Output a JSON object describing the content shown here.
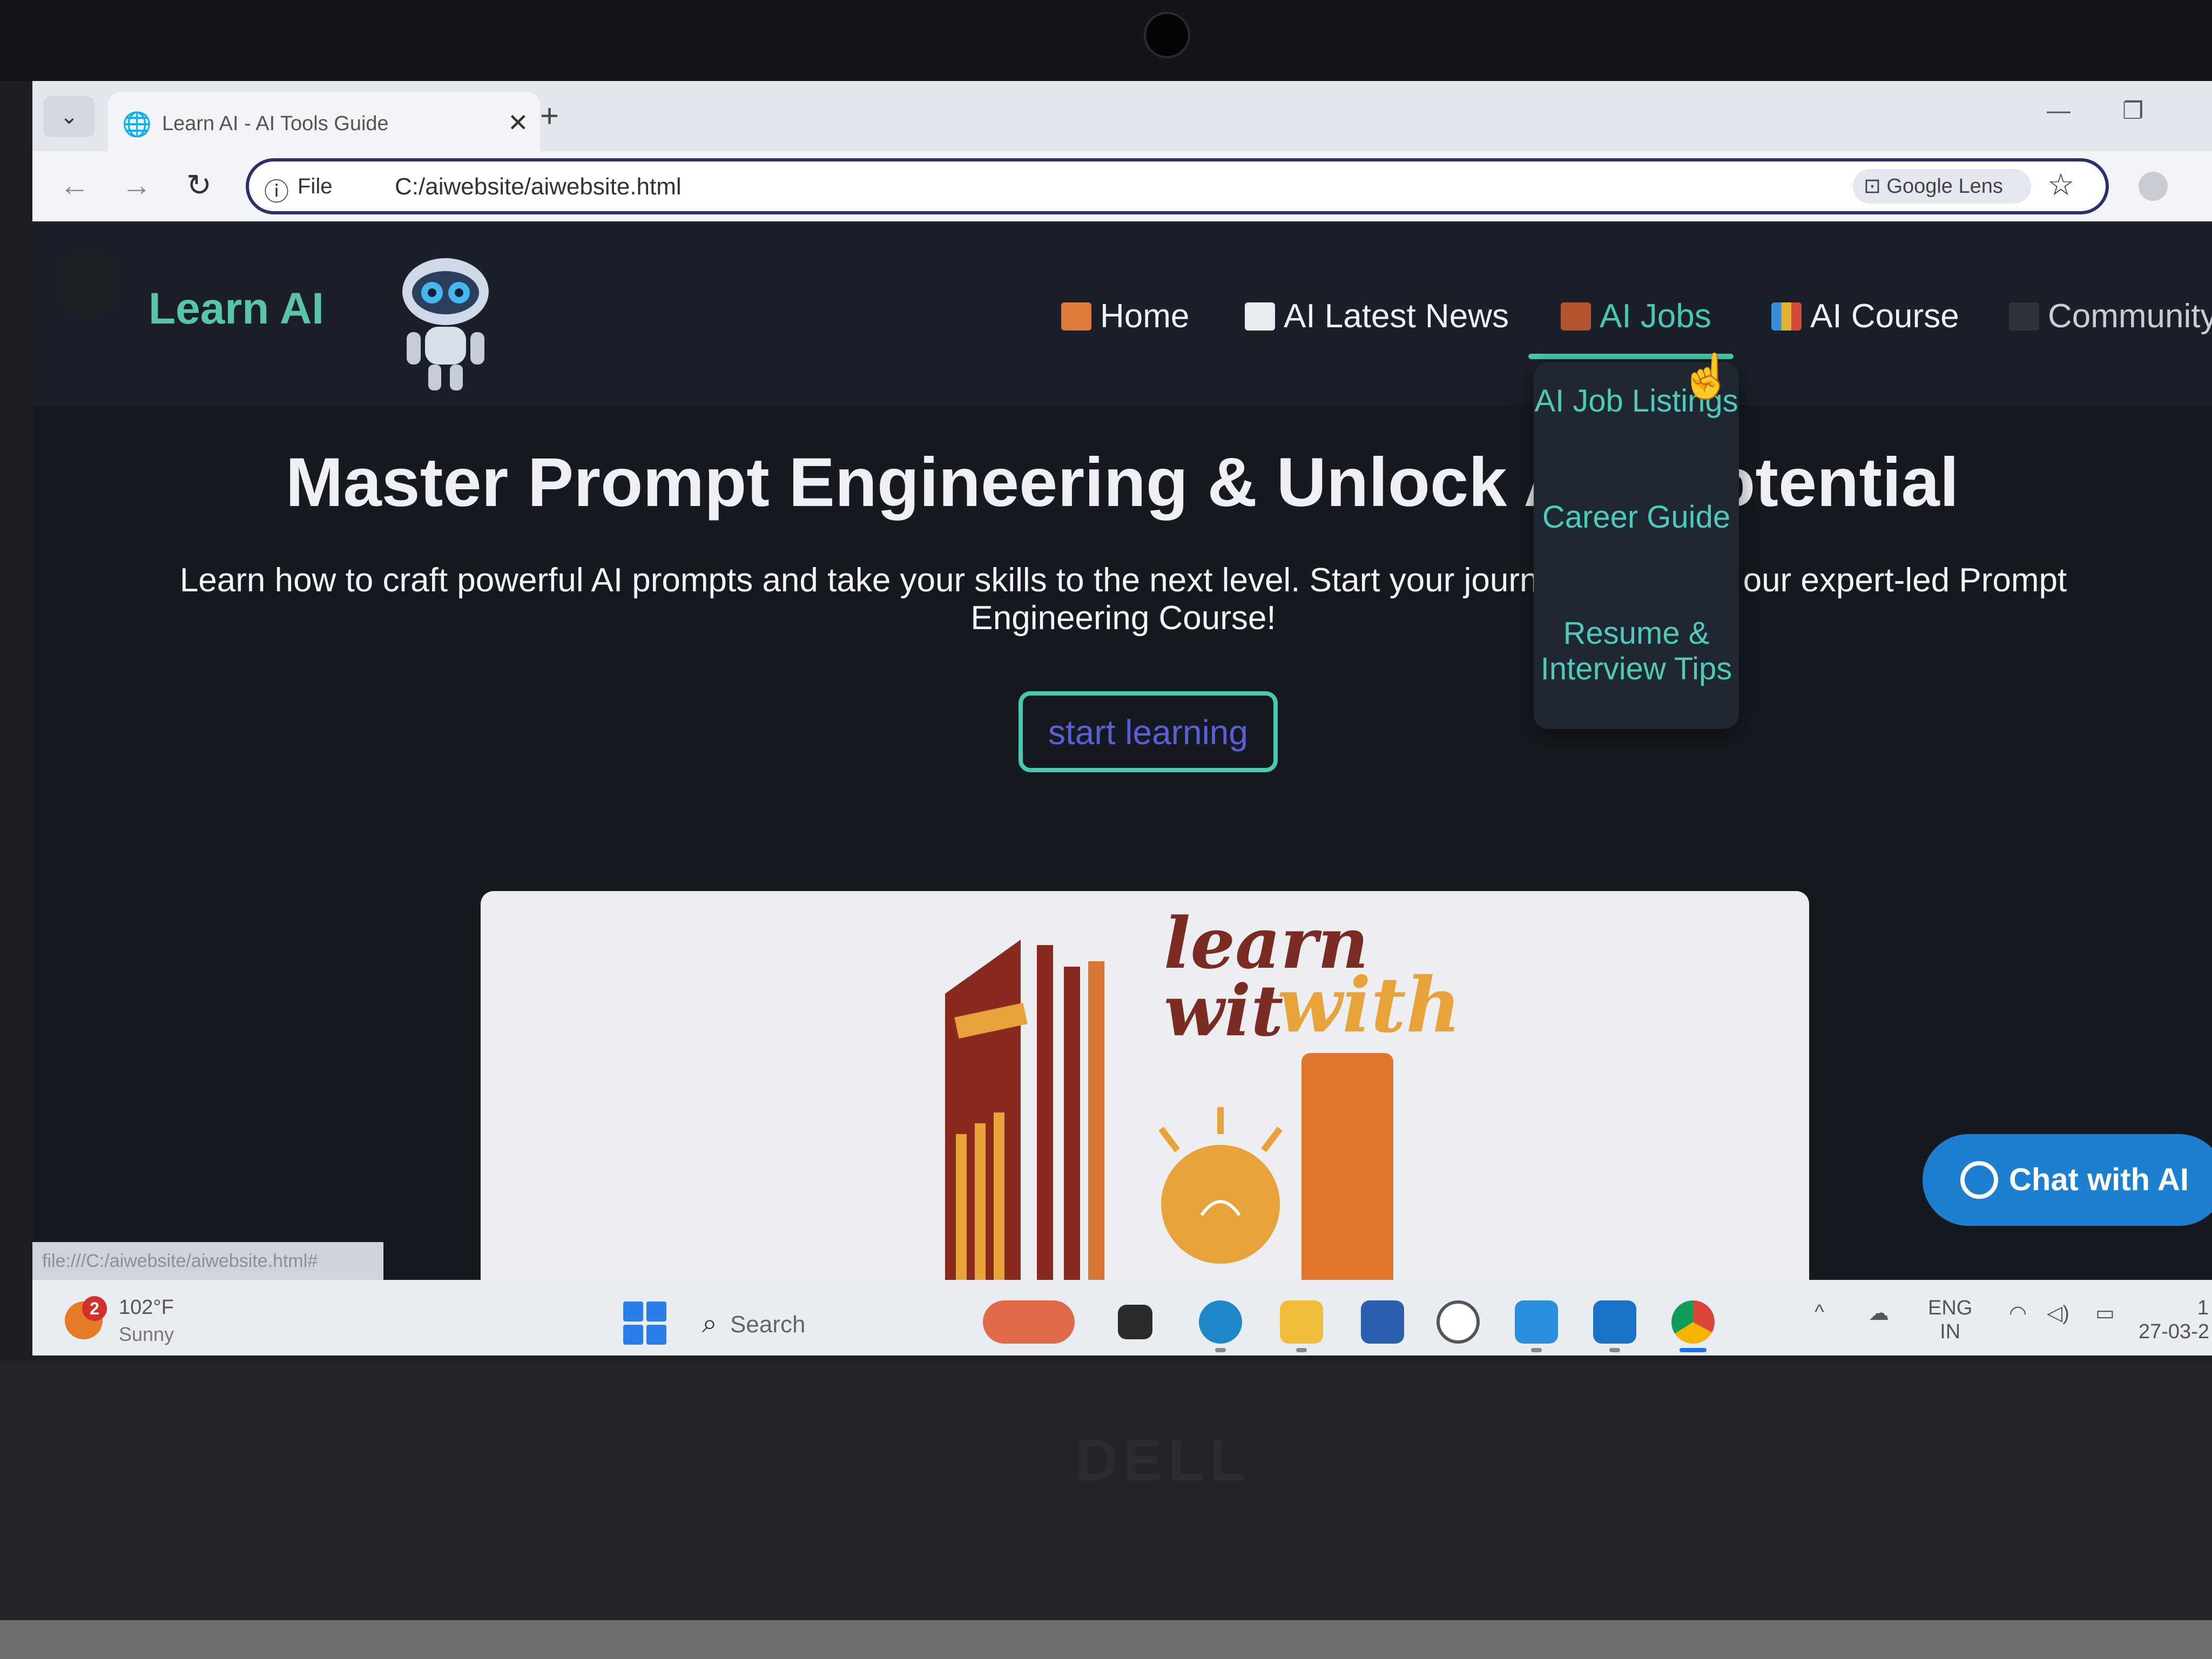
{
  "browser": {
    "tab_title": "Learn AI - AI Tools Guide",
    "url_scheme_label": "File",
    "url": "C:/aiwebsite/aiwebsite.html",
    "google_lens_label": "Google Lens",
    "status_url": "file:///C:/aiwebsite/aiwebsite.html#"
  },
  "site": {
    "logo_text": "Learn AI",
    "nav": [
      {
        "label": "Home",
        "icon": "house-icon"
      },
      {
        "label": "AI Latest News",
        "icon": "newspaper-icon"
      },
      {
        "label": "AI Jobs",
        "icon": "briefcase-icon",
        "active": true
      },
      {
        "label": "AI Course",
        "icon": "books-icon"
      },
      {
        "label": "Community",
        "icon": "people-icon"
      }
    ],
    "jobs_dropdown": [
      {
        "label": "AI Job Listings"
      },
      {
        "label": "Career Guide"
      },
      {
        "label": "Resume & Interview Tips"
      }
    ],
    "hero": {
      "title": "Master Prompt Engineering & Unlock AI’s Potential",
      "subtitle": "Learn how to craft powerful AI prompts and take your skills to the next level. Start your journey today with our expert-led Prompt Engineering Course!",
      "cta_label": "start learning"
    },
    "hero_image": {
      "line1": "learn",
      "line2_a": "wit",
      "line2_b": "with"
    },
    "chat_button_label": "Chat with AI"
  },
  "taskbar": {
    "weather_badge": "2",
    "weather_temp": "102°F",
    "weather_condition": "Sunny",
    "search_placeholder": "Search",
    "lang_line1": "ENG",
    "lang_line2": "IN",
    "date_partial": "27-03-2",
    "time_partial": "1"
  },
  "colors": {
    "accent": "#46c9b0",
    "cta_text": "#5a5fd8",
    "chat_button": "#1d7fd0",
    "page_background": "#161a20"
  }
}
